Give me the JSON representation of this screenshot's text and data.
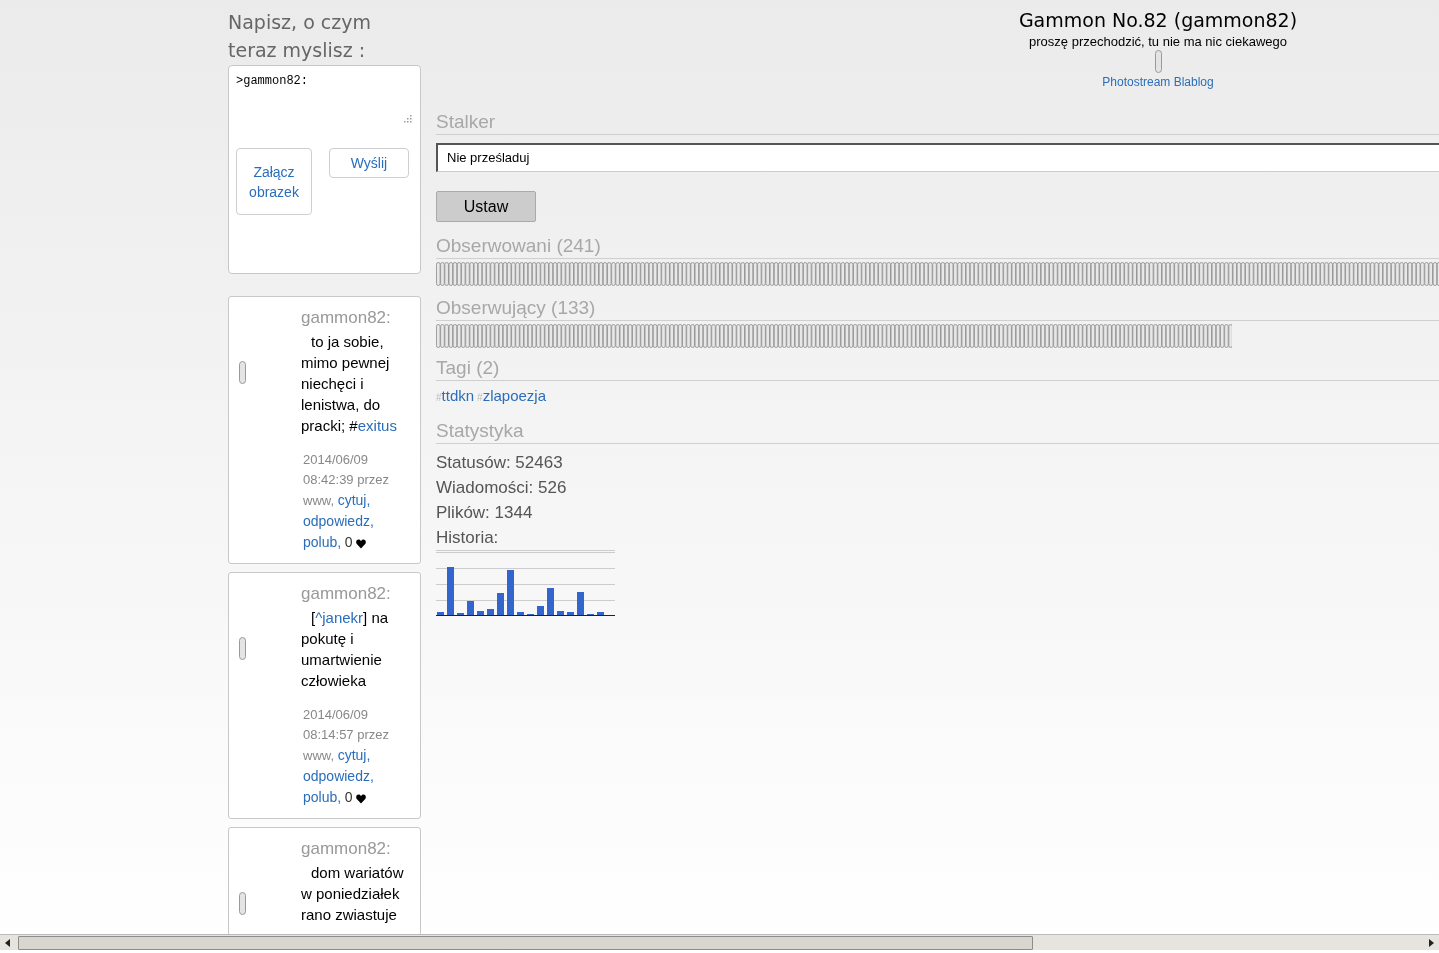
{
  "composer": {
    "heading": "Napisz, o czym teraz myslisz :",
    "value": ">gammon82:",
    "attach_button": "Załącz obrazek",
    "send_button": "Wyślij"
  },
  "posts": [
    {
      "author": "gammon82:",
      "body": [
        {
          "kind": "text",
          "text": "to ja sobie, mimo pewnej niechęci i lenistwa, do pracki; #"
        },
        {
          "kind": "link",
          "text": "exitus"
        }
      ],
      "date": "2014/06/09",
      "time": "08:42:39 przez",
      "source": "www,",
      "actions": [
        "cytuj,",
        "odpowiedz,",
        "polub,"
      ],
      "likes": "0"
    },
    {
      "author": "gammon82:",
      "body": [
        {
          "kind": "text",
          "text": "["
        },
        {
          "kind": "link",
          "text": "^janekr"
        },
        {
          "kind": "text",
          "text": "] na pokutę i umartwienie człowieka"
        }
      ],
      "date": "2014/06/09",
      "time": "08:14:57 przez",
      "source": "www,",
      "actions": [
        "cytuj,",
        "odpowiedz,",
        "polub,"
      ],
      "likes": "0"
    },
    {
      "author": "gammon82:",
      "body": [
        {
          "kind": "text",
          "text": "dom wariatów w poniedziałek rano zwiastuje"
        }
      ]
    }
  ],
  "profile": {
    "title": "Gammon No.82 (gammon82)",
    "subtitle": "proszę przechodzić, tu nie ma nic ciekawego",
    "links": "Photostream Blablog"
  },
  "stalker": {
    "heading": "Stalker",
    "value": "Nie prześladuj",
    "button": "Ustaw"
  },
  "watching": {
    "heading": "Obserwowani (241)"
  },
  "followers": {
    "heading": "Obserwujący (133)"
  },
  "tags": {
    "heading": "Tagi (2)",
    "items": [
      {
        "hash": "#",
        "label": "ttdkn"
      },
      {
        "hash": "#",
        "label": "zlapoezja"
      }
    ]
  },
  "stats": {
    "heading": "Statystyka",
    "lines": [
      "Statusów: 52463",
      "Wiadomości: 526",
      "Plików: 1344"
    ],
    "history_label": "Historia:"
  }
}
